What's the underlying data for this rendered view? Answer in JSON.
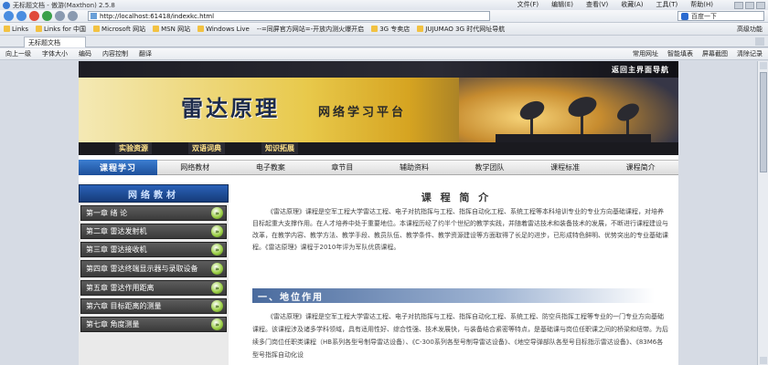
{
  "browser": {
    "window_title": "无标题文档 - 傲游(Maxthon) 2.5.8",
    "menu": [
      "文件(F)",
      "编辑(E)",
      "查看(V)",
      "收藏(A)",
      "工具(T)",
      "帮助(H)"
    ],
    "address": "http://localhost:61418/indexkc.html",
    "search_placeholder": "百度一下",
    "links": [
      "Links",
      "Links for 中国",
      "Microsoft 网站",
      "MSN 网站",
      "Windows Live",
      "--=同屏官方网站=-开放内测火爆开启",
      "3G 专卖店",
      "JUJUMAO 3G 时代网址导航"
    ],
    "links_right": [
      "高级功能"
    ],
    "tab_title": "无标题文档",
    "nav_left": [
      "向上一级",
      "字体大小",
      "编码",
      "内容控制",
      "翻译"
    ],
    "nav_right": [
      "常用网址",
      "智能填表",
      "屏幕截图",
      "清除记录"
    ]
  },
  "site": {
    "top_link": "返回主界面导航",
    "title": "雷达原理",
    "subtitle": "网络学习平台",
    "sub_links": [
      "实验资源",
      "双语词典",
      "知识拓展"
    ],
    "course_label": "课程学习",
    "nav_items": [
      "网络教材",
      "电子教案",
      "章节目",
      "辅助资料",
      "教学团队",
      "课程标准",
      "课程简介"
    ],
    "sidebar_head": "网络教材",
    "chapters": [
      {
        "label": "第一章    绪    论"
      },
      {
        "label": "第二章   雷达发射机"
      },
      {
        "label": "第三章   雷达接收机"
      },
      {
        "label": "第四章   雷达终端显示器与录取设备"
      },
      {
        "label": "第五章   雷达作用距离"
      },
      {
        "label": "第六章   目标距离的测量"
      },
      {
        "label": "第七章   角度测量"
      }
    ],
    "content_title": "课 程 简 介",
    "intro": "《雷达原理》课程是空军工程大学雷达工程、电子对抗指挥与工程、指挥自动化工程、系统工程等本科培训专业的专业方向基础课程，对培养目标起重大支撑作用。在人才培养中处于重要地位。本课程历经了约半个世纪的教学实践，并随着雷达技术和装备技术的发展，不断进行课程建设与改革，在教学内容、教学方法、教学手段、教员队伍、教学条件、教学资源建设等方面取得了长足的进步，已形成特色鲜明、优势突出的专业基础课程。《雷达原理》课程于2010年评为军队优质课程。",
    "section_heading": "一、地位作用",
    "section_text": "《雷达原理》课程是空军工程大学雷达工程、电子对抗指挥与工程、指挥自动化工程、系统工程、防空兵指挥工程等专业的一门专业方向基础课程。该课程涉及诸多学科领域，具有适用性好、综合性强、技术发展快，与装备结合紧密等特点，是基础课与岗位任职课之间的桥梁和纽带。为后续多门岗位任职类课程（HB系列各型号制导雷达设备）、《C-300系列各型号制导雷达设备》、《地空导弹部队各型号目标指示雷达设备》、《83M6各型号指挥自动化设"
  }
}
